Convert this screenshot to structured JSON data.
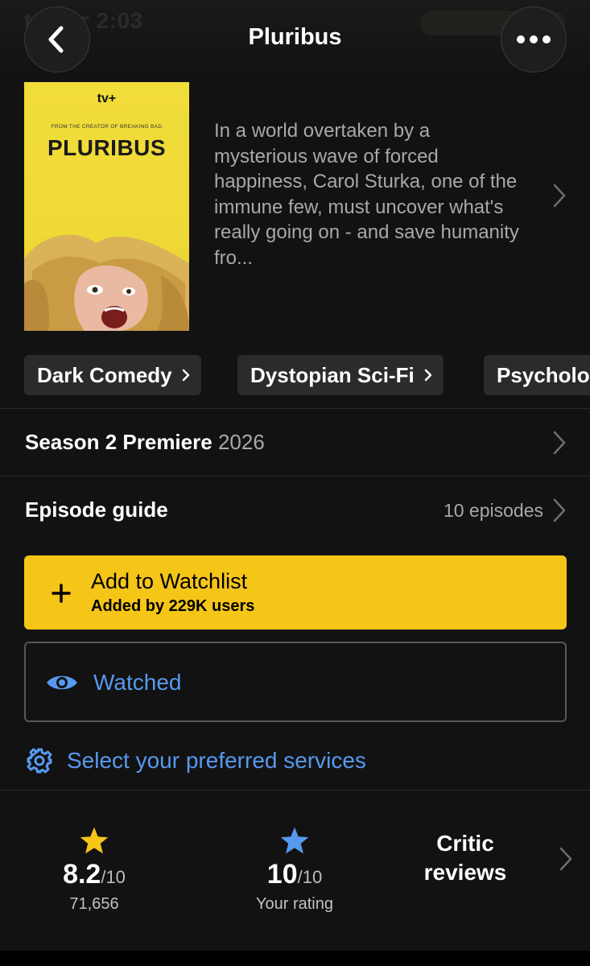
{
  "header": {
    "title": "Pluribus",
    "background_text": "trailer 2:03",
    "back_icon": "chevron-left-icon",
    "more_icon": "ellipsis-icon"
  },
  "poster": {
    "brand": "tv+",
    "from_line": "FROM THE CREATOR OF BREAKING BAD",
    "title": "PLURIBUS",
    "background_color": "#f1dd3a"
  },
  "synopsis": "In a world overtaken by a mysterious wave of forced happiness, Carol Sturka, one of the immune few, must uncover what's really going on - and save humanity fro...",
  "genres": [
    {
      "label": "Dark Comedy"
    },
    {
      "label": "Dystopian Sci-Fi"
    },
    {
      "label": "Psychological"
    }
  ],
  "season_row": {
    "label": "Season 2 Premiere",
    "year": "2026"
  },
  "episode_row": {
    "label": "Episode guide",
    "meta": "10 episodes"
  },
  "watchlist": {
    "title": "Add to Watchlist",
    "subtitle": "Added by 229K users",
    "color": "#f5c518"
  },
  "watched": {
    "label": "Watched",
    "icon": "eye-icon",
    "color": "#5799ef"
  },
  "services": {
    "label": "Select your preferred services",
    "icon": "gear-icon"
  },
  "ratings": {
    "imdb": {
      "score": "8.2",
      "denominator": "/10",
      "count": "71,656",
      "star_color": "#f5c518"
    },
    "user": {
      "score": "10",
      "denominator": "/10",
      "label": "Your rating",
      "star_color": "#5799ef"
    },
    "critic_label": "Critic reviews"
  }
}
